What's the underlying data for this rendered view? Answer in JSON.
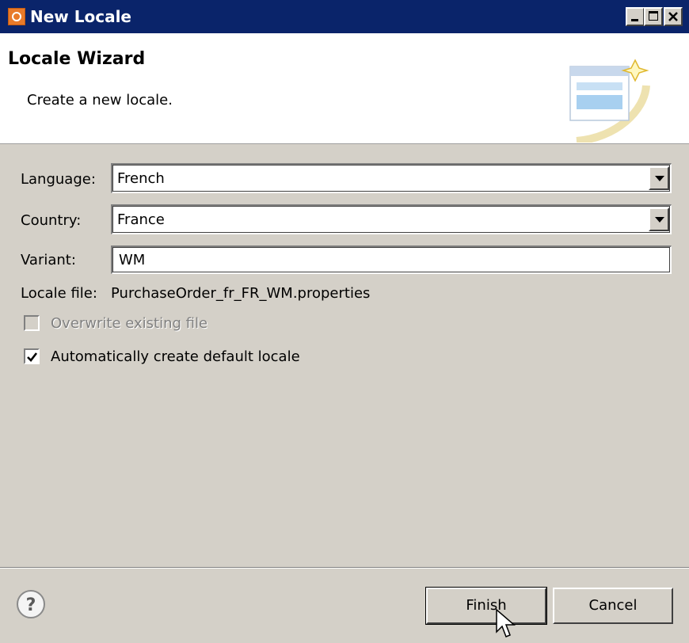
{
  "window": {
    "title": "New Locale"
  },
  "header": {
    "title": "Locale Wizard",
    "description": "Create a new locale."
  },
  "form": {
    "language_label": "Language:",
    "language_value": "French",
    "country_label": "Country:",
    "country_value": "France",
    "variant_label": "Variant:",
    "variant_value": "WM",
    "locale_file_label": "Locale file:",
    "locale_file_value": "PurchaseOrder_fr_FR_WM.properties",
    "overwrite_label": "Overwrite existing file",
    "overwrite_checked": false,
    "overwrite_enabled": false,
    "auto_default_label": "Automatically create default locale",
    "auto_default_checked": true
  },
  "buttons": {
    "finish_label": "Finish",
    "cancel_label": "Cancel"
  },
  "icons": {
    "app": "eclipse-icon",
    "help": "help-icon",
    "wizard": "wizard-banner-icon"
  },
  "colors": {
    "titlebar": "#0a246a",
    "dialog_bg": "#d4d0c8",
    "disabled_text": "#808080"
  }
}
